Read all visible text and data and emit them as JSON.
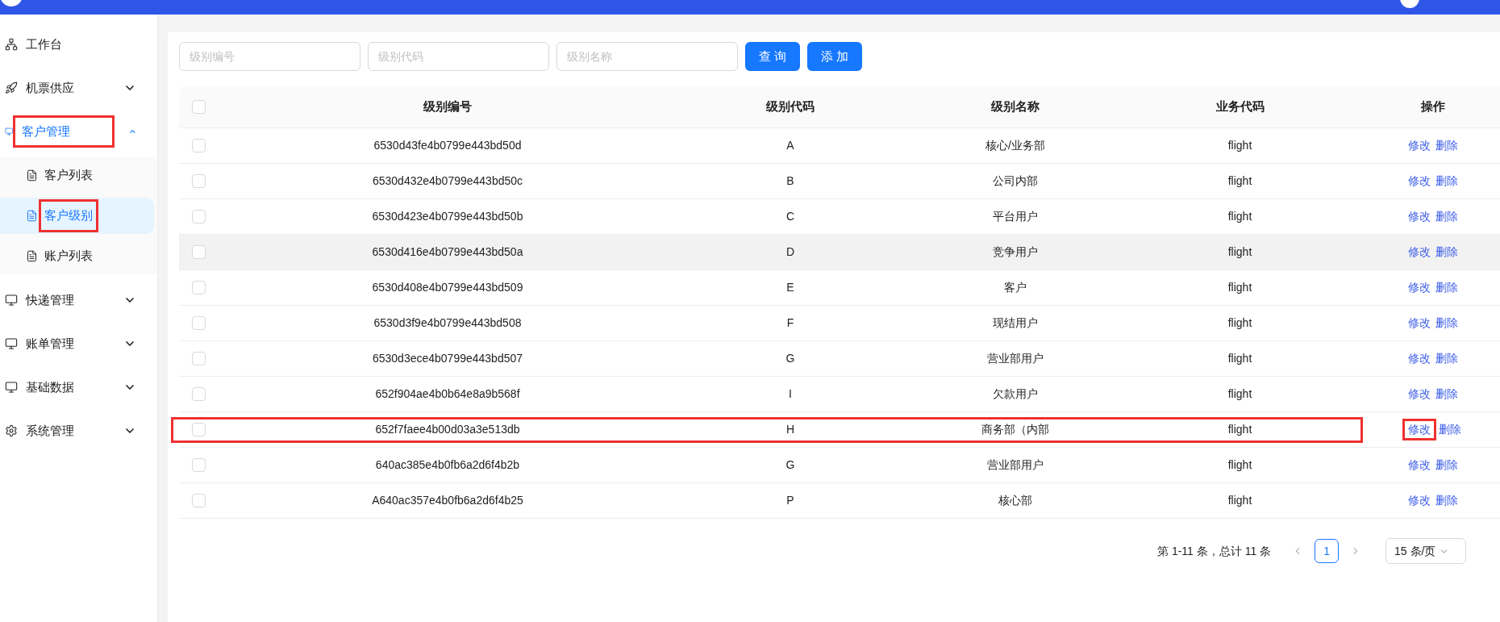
{
  "sidebar": {
    "items": [
      {
        "label": "工作台",
        "highlighted": false
      },
      {
        "label": "机票供应",
        "expanded": false,
        "highlighted": false
      },
      {
        "label": "客户管理",
        "expanded": true,
        "highlighted": true,
        "children": [
          {
            "label": "客户列表",
            "selected": false,
            "highlighted": false
          },
          {
            "label": "客户级别",
            "selected": true,
            "highlighted": true
          },
          {
            "label": "账户列表",
            "selected": false,
            "highlighted": false
          }
        ]
      },
      {
        "label": "快递管理",
        "expanded": false,
        "highlighted": false
      },
      {
        "label": "账单管理",
        "expanded": false,
        "highlighted": false
      },
      {
        "label": "基础数据",
        "expanded": false,
        "highlighted": false
      },
      {
        "label": "系统管理",
        "expanded": false,
        "highlighted": false
      }
    ]
  },
  "filters": [
    {
      "placeholder": "级别编号"
    },
    {
      "placeholder": "级别代码"
    },
    {
      "placeholder": "级别名称"
    }
  ],
  "buttons": [
    "查 询",
    "添 加"
  ],
  "table": {
    "select_all": {
      "checked": false
    },
    "columns": [
      "级别编号",
      "级别代码",
      "级别名称",
      "业务代码",
      "操作"
    ],
    "rows": [
      {
        "cells": [
          "6530d43fe4b0799e443bd50d",
          "A",
          "核心/业务部",
          "flight"
        ],
        "actions": [
          "修改",
          "删除"
        ],
        "checked": false,
        "hovered": false,
        "highlighted": false,
        "edit_highlighted": false
      },
      {
        "cells": [
          "6530d432e4b0799e443bd50c",
          "B",
          "公司内部",
          "flight"
        ],
        "actions": [
          "修改",
          "删除"
        ],
        "checked": false,
        "hovered": false,
        "highlighted": false,
        "edit_highlighted": false
      },
      {
        "cells": [
          "6530d423e4b0799e443bd50b",
          "C",
          "平台用户",
          "flight"
        ],
        "actions": [
          "修改",
          "删除"
        ],
        "checked": false,
        "hovered": false,
        "highlighted": false,
        "edit_highlighted": false
      },
      {
        "cells": [
          "6530d416e4b0799e443bd50a",
          "D",
          "竞争用户",
          "flight"
        ],
        "actions": [
          "修改",
          "删除"
        ],
        "checked": false,
        "hovered": true,
        "highlighted": false,
        "edit_highlighted": false
      },
      {
        "cells": [
          "6530d408e4b0799e443bd509",
          "E",
          "客户",
          "flight"
        ],
        "actions": [
          "修改",
          "删除"
        ],
        "checked": false,
        "hovered": false,
        "highlighted": false,
        "edit_highlighted": false
      },
      {
        "cells": [
          "6530d3f9e4b0799e443bd508",
          "F",
          "现结用户",
          "flight"
        ],
        "actions": [
          "修改",
          "删除"
        ],
        "checked": false,
        "hovered": false,
        "highlighted": false,
        "edit_highlighted": false
      },
      {
        "cells": [
          "6530d3ece4b0799e443bd507",
          "G",
          "营业部用户",
          "flight"
        ],
        "actions": [
          "修改",
          "删除"
        ],
        "checked": false,
        "hovered": false,
        "highlighted": false,
        "edit_highlighted": false
      },
      {
        "cells": [
          "652f904ae4b0b64e8a9b568f",
          "I",
          "欠款用户",
          "flight"
        ],
        "actions": [
          "修改",
          "删除"
        ],
        "checked": false,
        "hovered": false,
        "highlighted": false,
        "edit_highlighted": false
      },
      {
        "cells": [
          "652f7faee4b00d03a3e513db",
          "H",
          "商务部（内部",
          "flight"
        ],
        "actions": [
          "修改",
          "删除"
        ],
        "checked": false,
        "hovered": false,
        "highlighted": true,
        "edit_highlighted": true
      },
      {
        "cells": [
          "640ac385e4b0fb6a2d6f4b2b",
          "G",
          "营业部用户",
          "flight"
        ],
        "actions": [
          "修改",
          "删除"
        ],
        "checked": false,
        "hovered": false,
        "highlighted": false,
        "edit_highlighted": false
      },
      {
        "cells": [
          "A640ac357e4b0fb6a2d6f4b25",
          "P",
          "核心部",
          "flight"
        ],
        "actions": [
          "修改",
          "删除"
        ],
        "checked": false,
        "hovered": false,
        "highlighted": false,
        "edit_highlighted": false
      }
    ]
  },
  "pagination": {
    "summary": "第 1-11 条，总计 11 条",
    "pages": [
      {
        "label": "1",
        "selected": true
      }
    ],
    "page_size": "15 条/页"
  }
}
